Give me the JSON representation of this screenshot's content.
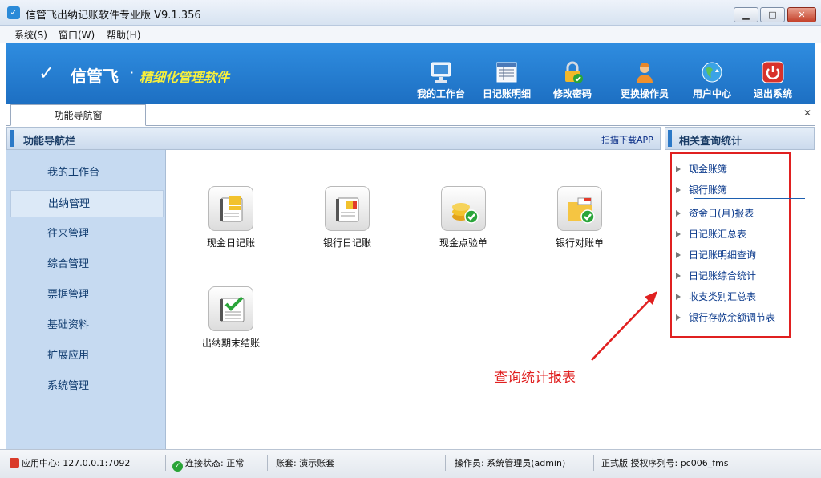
{
  "window": {
    "title": "信管飞出纳记账软件专业版 V9.1.356",
    "min_label": "▁",
    "max_label": "□",
    "close_label": "✕"
  },
  "menu": {
    "items": [
      "系统(S)",
      "窗口(W)",
      "帮助(H)"
    ]
  },
  "banner": {
    "logo_text": "信管飞",
    "slogan": "精细化管理软件",
    "tools": [
      {
        "label": "我的工作台",
        "icon": "monitor-icon"
      },
      {
        "label": "日记账明细",
        "icon": "ledger-detail-icon"
      },
      {
        "label": "修改密码",
        "icon": "lock-icon"
      },
      {
        "label": "更换操作员",
        "icon": "user-icon"
      },
      {
        "label": "用户中心",
        "icon": "globe-icon"
      },
      {
        "label": "退出系统",
        "icon": "power-icon"
      }
    ]
  },
  "tabs": [
    {
      "label": "功能导航窗"
    }
  ],
  "nav": {
    "header": "功能导航栏",
    "download_link": "扫描下载APP",
    "items": [
      "我的工作台",
      "出纳管理",
      "往来管理",
      "综合管理",
      "票据管理",
      "基础资料",
      "扩展应用",
      "系统管理"
    ],
    "active": "出纳管理"
  },
  "functions": [
    {
      "label": "现金日记账",
      "icon": "cash-journal-icon"
    },
    {
      "label": "银行日记账",
      "icon": "bank-journal-icon"
    },
    {
      "label": "现金点验单",
      "icon": "coins-check-icon"
    },
    {
      "label": "银行对账单",
      "icon": "folder-check-icon"
    },
    {
      "label": "出纳期末结账",
      "icon": "notebook-check-icon"
    }
  ],
  "right_panel": {
    "header": "相关查询统计",
    "items": [
      "现金账簿",
      "银行账簿",
      "资金日(月)报表",
      "日记账汇总表",
      "日记账明细查询",
      "日记账综合统计",
      "收支类别汇总表",
      "银行存款余额调节表"
    ]
  },
  "annotation": "查询统计报表",
  "status": {
    "app_center": "应用中心: 127.0.0.1:7092",
    "connection": "连接状态: 正常",
    "account_set": "账套: 演示账套",
    "operator": "操作员: 系统管理员(admin)",
    "license": "正式版 授权序列号: pc006_fms"
  },
  "colors": {
    "banner": "#2780d6",
    "nav_bg": "#c6daf1",
    "accent_red": "#e02020",
    "slogan": "#f7ef3c"
  }
}
